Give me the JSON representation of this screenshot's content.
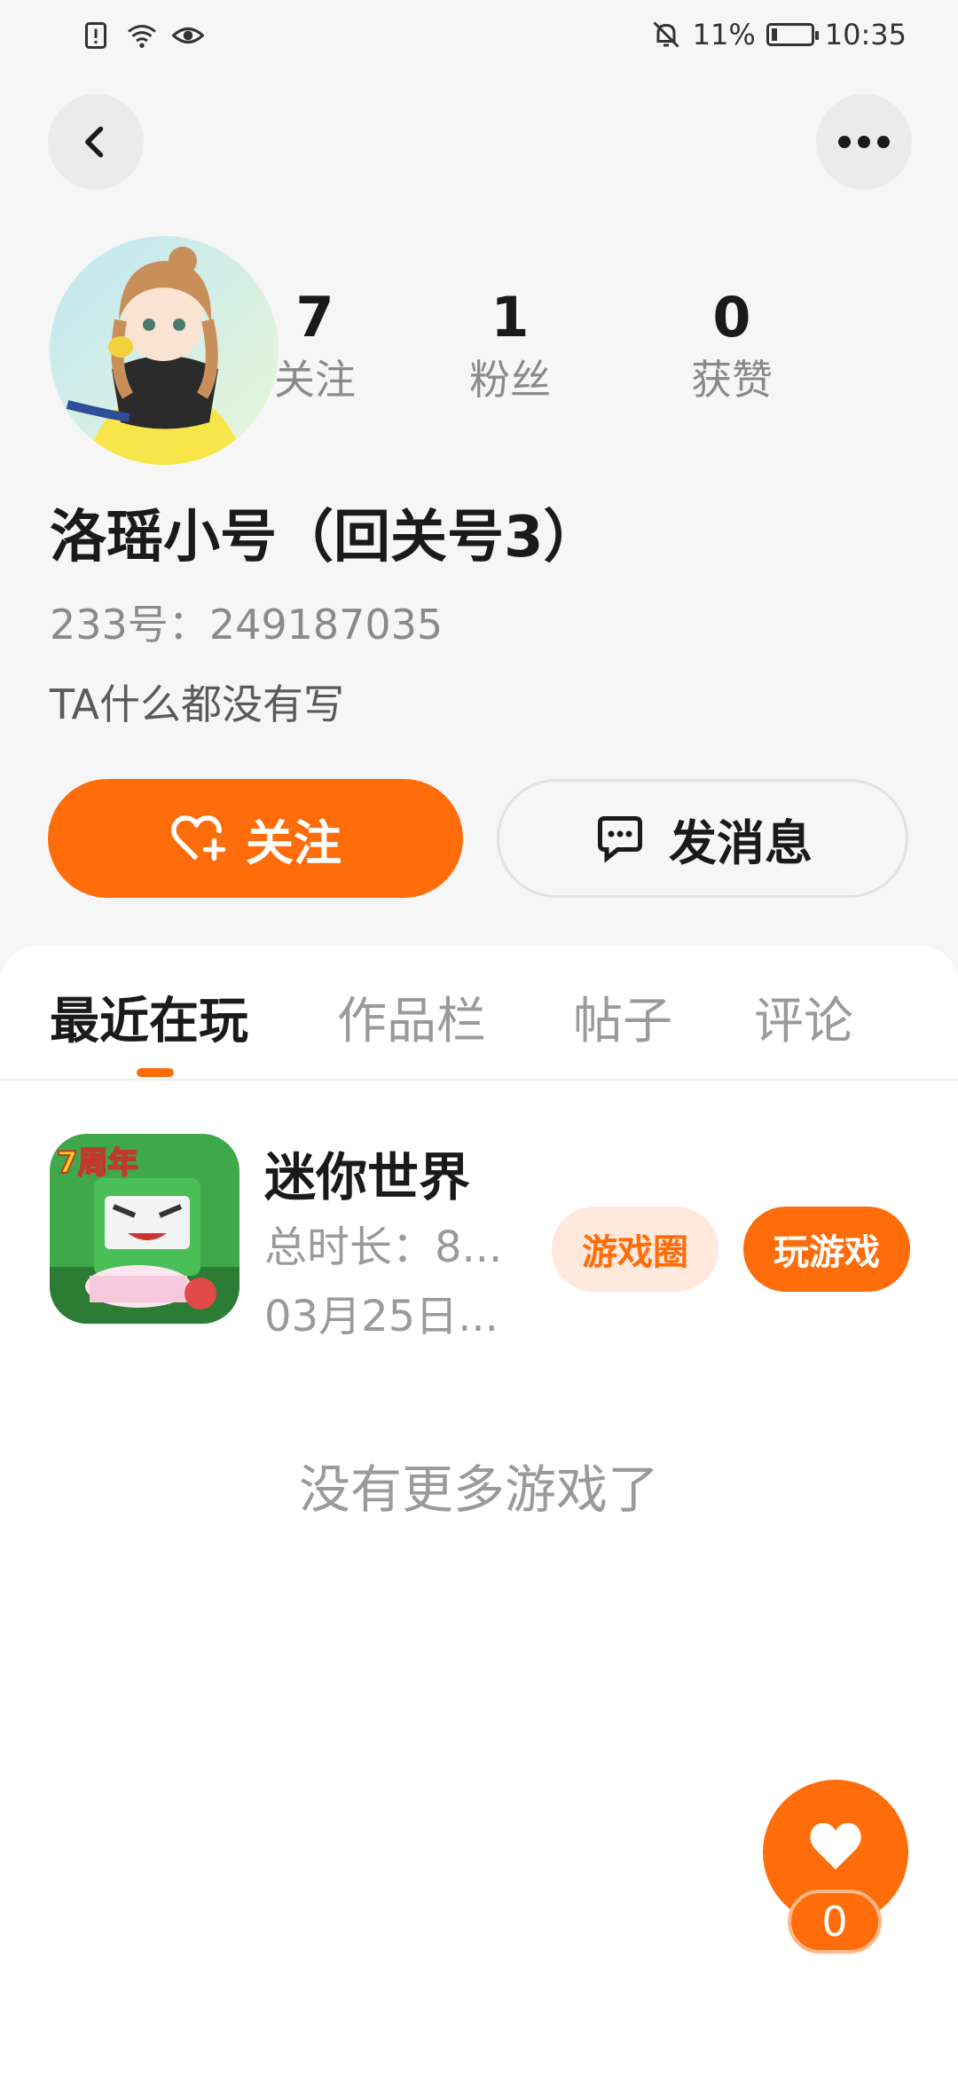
{
  "status_bar": {
    "battery_percent": "11%",
    "time": "10:35"
  },
  "profile": {
    "stats": [
      {
        "value": "7",
        "label": "关注"
      },
      {
        "value": "1",
        "label": "粉丝"
      },
      {
        "value": "0",
        "label": "获赞"
      }
    ],
    "name": "洛瑶小号（回关号3）",
    "id_line": "233号：249187035",
    "bio": "TA什么都没有写"
  },
  "actions": {
    "follow_label": "关注",
    "message_label": "发消息"
  },
  "tabs": [
    {
      "label": "最近在玩",
      "active": true
    },
    {
      "label": "作品栏",
      "active": false
    },
    {
      "label": "帖子",
      "active": false
    },
    {
      "label": "评论",
      "active": false
    }
  ],
  "games": [
    {
      "title": "迷你世界",
      "duration": "总时长：8...",
      "date": "03月25日...",
      "icon_text": "7周年",
      "circle_label": "游戏圈",
      "play_label": "玩游戏"
    }
  ],
  "empty_text": "没有更多游戏了",
  "like_fab": {
    "count": "0"
  },
  "colors": {
    "accent": "#ff6c0a",
    "accent_light": "#ffe8dc",
    "background": "#f6f6f6"
  }
}
